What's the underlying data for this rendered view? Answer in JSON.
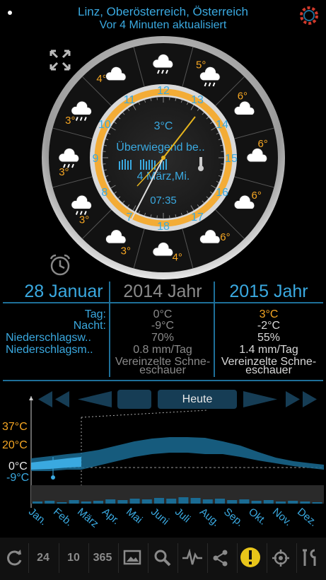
{
  "header": {
    "location": "Linz, Oberösterreich, Österreich",
    "updated": "Vor 4 Minuten aktualisiert"
  },
  "clock": {
    "current_temp": "3°C",
    "condition": "Überwiegend be..",
    "date": "4 März,Mi.",
    "time": "07:35",
    "hour_labels": [
      "12",
      "13",
      "14",
      "15",
      "16",
      "17",
      "18",
      "7",
      "8",
      "9",
      "10",
      "11"
    ],
    "ring_temps": [
      "5°",
      "6°",
      "6°",
      "6°",
      "6°",
      "4°",
      "3°",
      "3°",
      "3°",
      "3°",
      "4°"
    ],
    "icons": [
      "rain-cloud-icon",
      "rain-cloud-icon",
      "cloud-icon",
      "cloud-icon",
      "cloud-icon",
      "cloud-icon",
      "cloud-icon",
      "partly-cloudy-sun-icon",
      "cloud-rain-icon",
      "rain-cloud-icon",
      "rain-cloud-icon",
      "cloud-sun-icon"
    ]
  },
  "comparison": {
    "date_label": "28 Januar",
    "year1": "2014 Jahr",
    "year2": "2015 Jahr",
    "rows": [
      {
        "label": "Tag:",
        "v1": "0°C",
        "v2": "3°C"
      },
      {
        "label": "Nacht:",
        "v1": "-9°C",
        "v2": "-2°C"
      },
      {
        "label": "Niederschlagsw..",
        "v1": "70%",
        "v2": "55%"
      },
      {
        "label": "Niederschlagsm..",
        "v1": "0.8 mm/Tag",
        "v2": "1.4 mm/Tag"
      }
    ],
    "desc1_line1": "Vereinzelte Schne-",
    "desc1_line2": "eschauer",
    "desc2_line1": "Vereinzelte Schne-",
    "desc2_line2": "eschauer"
  },
  "graph": {
    "today_label": "Heute",
    "y_labels": [
      "37°C",
      "20°C",
      "0°C",
      "-9°C"
    ],
    "months": [
      "Jan.",
      "Feb.",
      "März",
      "Apr.",
      "Mai",
      "Juni",
      "Juli",
      "Aug.",
      "Sep.",
      "Okt.",
      "Nov.",
      "Dez."
    ]
  },
  "toolbar": {
    "items": [
      "24",
      "10",
      "365"
    ]
  },
  "colors": {
    "accent": "#3aa9e0",
    "warm": "#f5a623",
    "warning": "#e8c51a"
  }
}
